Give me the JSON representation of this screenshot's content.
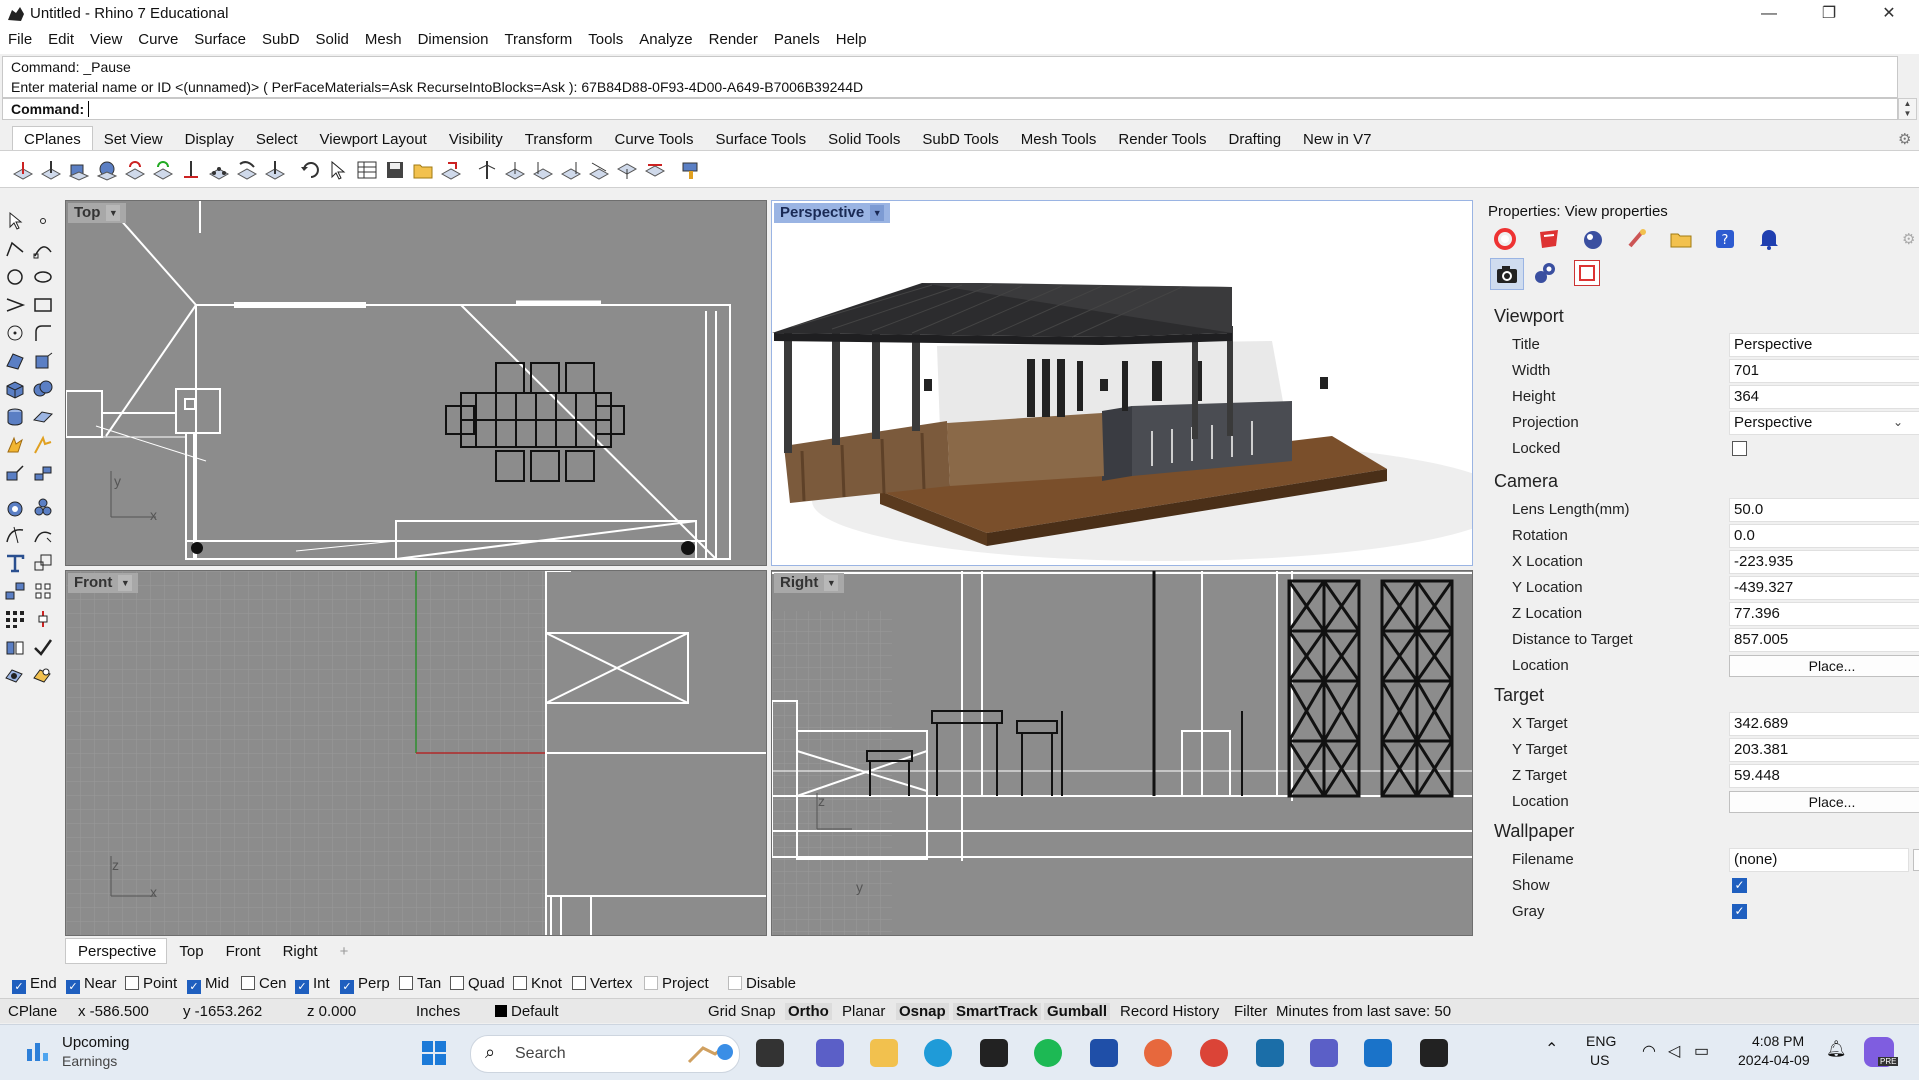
{
  "window": {
    "title": "Untitled - Rhino 7 Educational",
    "minimize": "—",
    "maximize": "❐",
    "close": "✕"
  },
  "menu": [
    "File",
    "Edit",
    "View",
    "Curve",
    "Surface",
    "SubD",
    "Solid",
    "Mesh",
    "Dimension",
    "Transform",
    "Tools",
    "Analyze",
    "Render",
    "Panels",
    "Help"
  ],
  "command": {
    "history_1": "Command: _Pause",
    "history_2": "Enter material name or ID <(unnamed)> ( PerFaceMaterials=Ask  RecurseIntoBlocks=Ask ): 67B84D88-0F93-4D00-A649-B7006B39244D",
    "prompt": "Command:",
    "value": ""
  },
  "tool_tabs": [
    "CPlanes",
    "Set View",
    "Display",
    "Select",
    "Viewport Layout",
    "Visibility",
    "Transform",
    "Curve Tools",
    "Surface Tools",
    "Solid Tools",
    "SubD Tools",
    "Mesh Tools",
    "Render Tools",
    "Drafting",
    "New in V7"
  ],
  "viewports": {
    "top": "Top",
    "perspective": "Perspective",
    "front": "Front",
    "right": "Right",
    "axis_x": "x",
    "axis_y": "y",
    "axis_z": "z"
  },
  "viewport_tabs": [
    "Perspective",
    "Top",
    "Front",
    "Right"
  ],
  "viewport_tab_add": "+",
  "properties": {
    "header": "Properties: View properties",
    "viewport": {
      "section": "Viewport",
      "title_label": "Title",
      "title_value": "Perspective",
      "width_label": "Width",
      "width_value": "701",
      "height_label": "Height",
      "height_value": "364",
      "projection_label": "Projection",
      "projection_value": "Perspective",
      "locked_label": "Locked",
      "locked": false
    },
    "camera": {
      "section": "Camera",
      "lens_label": "Lens Length(mm)",
      "lens_value": "50.0",
      "rotation_label": "Rotation",
      "rotation_value": "0.0",
      "xloc_label": "X Location",
      "xloc_value": "-223.935",
      "yloc_label": "Y Location",
      "yloc_value": "-439.327",
      "zloc_label": "Z Location",
      "zloc_value": "77.396",
      "dist_label": "Distance to Target",
      "dist_value": "857.005",
      "location_label": "Location",
      "place_button": "Place..."
    },
    "target": {
      "section": "Target",
      "x_label": "X Target",
      "x_value": "342.689",
      "y_label": "Y Target",
      "y_value": "203.381",
      "z_label": "Z Target",
      "z_value": "59.448",
      "location_label": "Location",
      "place_button": "Place..."
    },
    "wallpaper": {
      "section": "Wallpaper",
      "filename_label": "Filename",
      "filename_value": "(none)",
      "browse": "...",
      "show_label": "Show",
      "show": true,
      "gray_label": "Gray",
      "gray": true
    }
  },
  "osnap": [
    {
      "label": "End",
      "checked": true
    },
    {
      "label": "Near",
      "checked": true
    },
    {
      "label": "Point",
      "checked": false
    },
    {
      "label": "Mid",
      "checked": true
    },
    {
      "label": "Cen",
      "checked": false
    },
    {
      "label": "Int",
      "checked": true
    },
    {
      "label": "Perp",
      "checked": true
    },
    {
      "label": "Tan",
      "checked": false
    },
    {
      "label": "Quad",
      "checked": false
    },
    {
      "label": "Knot",
      "checked": false
    },
    {
      "label": "Vertex",
      "checked": false
    },
    {
      "label": "Project",
      "checked": false
    },
    {
      "label": "Disable",
      "checked": false
    }
  ],
  "status": {
    "cplane": "CPlane",
    "x": "x -586.500",
    "y": "y -1653.262",
    "z": "z 0.000",
    "units": "Inches",
    "layer": "Default",
    "grid_snap": "Grid Snap",
    "ortho": "Ortho",
    "planar": "Planar",
    "osnap": "Osnap",
    "smarttrack": "SmartTrack",
    "gumball": "Gumball",
    "record_history": "Record History",
    "filter": "Filter",
    "minutes": "Minutes from last save: 50"
  },
  "taskbar": {
    "widget_title": "Upcoming",
    "widget_sub": "Earnings",
    "search": "Search",
    "lang1": "ENG",
    "lang2": "US",
    "time": "4:08 PM",
    "date": "2024-04-09",
    "copilot_badge": "PRE"
  },
  "colors": {
    "accent": "#1f5fbf",
    "viewport_bg": "#8c8c8c",
    "active_label": "#9ab4e3"
  }
}
